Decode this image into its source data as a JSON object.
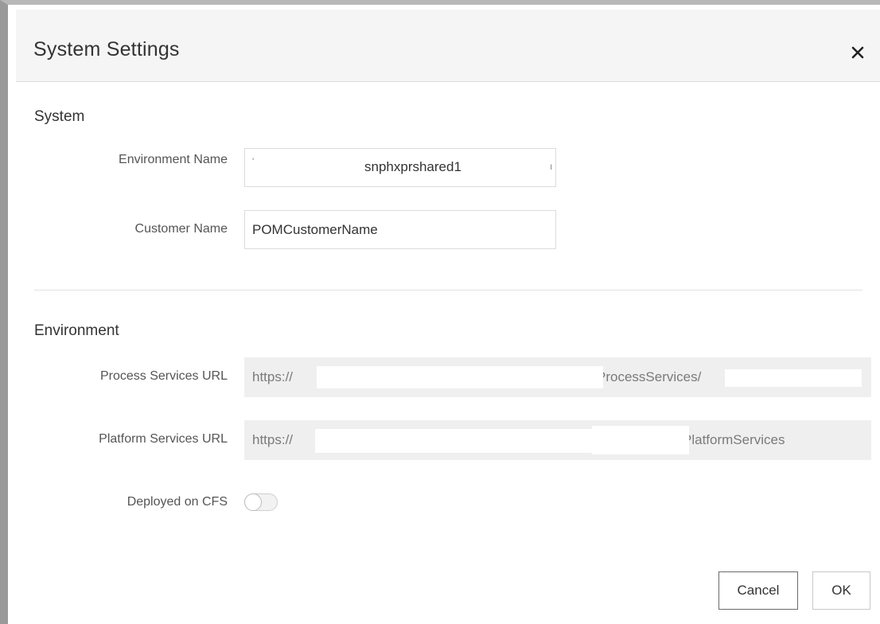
{
  "dialog": {
    "title": "System Settings",
    "close_icon": "close-icon"
  },
  "system": {
    "heading": "System",
    "environment_name_label": "Environment Name",
    "environment_name_value": "snphxprshared1",
    "customer_name_label": "Customer Name",
    "customer_name_value": "POMCustomerName"
  },
  "environment": {
    "heading": "Environment",
    "process_services_url_label": "Process Services URL",
    "process_services_url_prefix": "https://",
    "process_services_url_visible": "ProcessServices/",
    "platform_services_url_label": "Platform Services URL",
    "platform_services_url_prefix": "https://",
    "platform_services_url_visible": "PlatformServices",
    "deployed_on_cfs_label": "Deployed on CFS",
    "deployed_on_cfs_enabled": false
  },
  "footer": {
    "cancel_label": "Cancel",
    "ok_label": "OK"
  },
  "colors": {
    "header_bg": "#f5f5f5",
    "readonly_field_bg": "#efefef",
    "text": "#333333",
    "label": "#555555"
  }
}
